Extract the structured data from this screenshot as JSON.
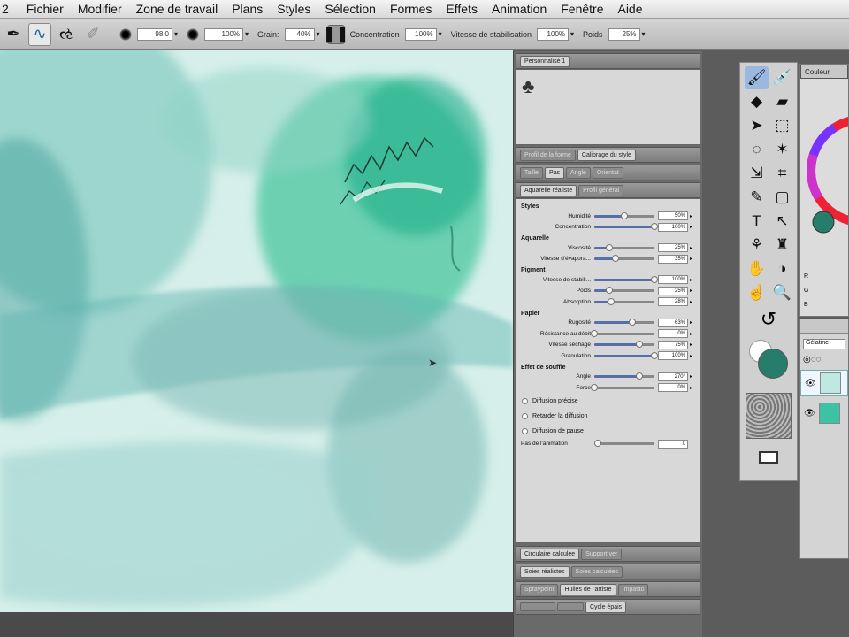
{
  "menu": [
    "2",
    "Fichier",
    "Modifier",
    "Zone de travail",
    "Plans",
    "Styles",
    "Sélection",
    "Formes",
    "Effets",
    "Animation",
    "Fenêtre",
    "Aide"
  ],
  "propbar": {
    "size_value": "98,0",
    "opacity_value": "100%",
    "grain_label": "Grain:",
    "grain_value": "40%",
    "concentration_label": "Concentration",
    "concentration_value": "100%",
    "stabilization_label": "Vitesse de stabilisation",
    "stabilization_value": "100%",
    "weight_label": "Poids",
    "weight_value": "25%"
  },
  "panels": {
    "custom_title": "Personnalisé 1",
    "calib_tabs": [
      "Profil de la forme",
      "Calibrage du style"
    ],
    "style_tabs": [
      "Taille",
      "Pas",
      "Angle",
      "Orientat"
    ],
    "params_tabs": [
      "Aquarelle réaliste",
      "Profil général"
    ],
    "sections": [
      {
        "title": "Styles",
        "rows": [
          {
            "label": "Humidité",
            "value": "50%",
            "level": 0.5
          },
          {
            "label": "Concentration",
            "value": "100%",
            "level": 1.0
          }
        ]
      },
      {
        "title": "Aquarelle",
        "rows": [
          {
            "label": "Viscosité",
            "value": "25%",
            "level": 0.25
          },
          {
            "label": "Vitesse d'évapora...",
            "value": "35%",
            "level": 0.35
          }
        ]
      },
      {
        "title": "Pigment",
        "rows": [
          {
            "label": "Vitesse de stabili...",
            "value": "100%",
            "level": 1.0
          },
          {
            "label": "Poids",
            "value": "25%",
            "level": 0.25
          },
          {
            "label": "Absorption",
            "value": "28%",
            "level": 0.28
          }
        ]
      },
      {
        "title": "Papier",
        "rows": [
          {
            "label": "Rugosité",
            "value": "63%",
            "level": 0.63
          },
          {
            "label": "Résistance au débit",
            "value": "0%",
            "level": 0.0
          },
          {
            "label": "Vitesse séchage",
            "value": "75%",
            "level": 0.75
          },
          {
            "label": "Granulation",
            "value": "100%",
            "level": 1.0
          }
        ]
      },
      {
        "title": "Effet de souffle",
        "rows": [
          {
            "label": "Angle",
            "value": "270°",
            "level": 0.75
          },
          {
            "label": "Force",
            "value": "0%",
            "level": 0.0
          }
        ]
      }
    ],
    "checkboxes": [
      "Diffusion précise",
      "Retarder la diffusion",
      "Diffusion de pause"
    ],
    "anim_row": {
      "label": "Pas de l'animation",
      "value": "0",
      "level": 0.0
    },
    "bottom_tabs": [
      [
        "Circulaire calculée",
        "Support ver"
      ],
      [
        "Soies réalistes",
        "Soies calculées"
      ],
      [
        "Spraypeint",
        "Huiles de l'artiste",
        "Impasto"
      ],
      [
        "",
        "",
        "",
        "Cycle épais"
      ]
    ]
  },
  "toolbox": {
    "tools": [
      [
        "brush-icon",
        "🖌"
      ],
      [
        "eyedropper-icon",
        "💉"
      ],
      [
        "eraser-fill-icon",
        "◆"
      ],
      [
        "eraser-icon",
        "▰"
      ],
      [
        "arrow-icon",
        "➤"
      ],
      [
        "marquee-icon",
        "⬚"
      ],
      [
        "lasso-icon",
        "◌"
      ],
      [
        "magic-wand-icon",
        "✶"
      ],
      [
        "transform-icon",
        "⇲"
      ],
      [
        "crop-icon",
        "⌗"
      ],
      [
        "pen-icon",
        "✎"
      ],
      [
        "rectangle-icon",
        "▢"
      ],
      [
        "text-icon",
        "T"
      ],
      [
        "shape-select-icon",
        "↖"
      ],
      [
        "cloner-icon",
        "⚘"
      ],
      [
        "rubber-stamp-icon",
        "♜"
      ],
      [
        "dodge-icon",
        "✋"
      ],
      [
        "burn-icon",
        "◑"
      ],
      [
        "grabber-icon",
        "☝"
      ],
      [
        "magnifier-icon",
        "🔍"
      ]
    ],
    "rotate_icon": "↺",
    "main_color": "#267d6b",
    "secondary_color": "#ffffff"
  },
  "color_panel": {
    "title": "Couleur",
    "labels": [
      "R",
      "G",
      "B"
    ]
  },
  "layers": {
    "blend_mode": "Gélatine"
  }
}
